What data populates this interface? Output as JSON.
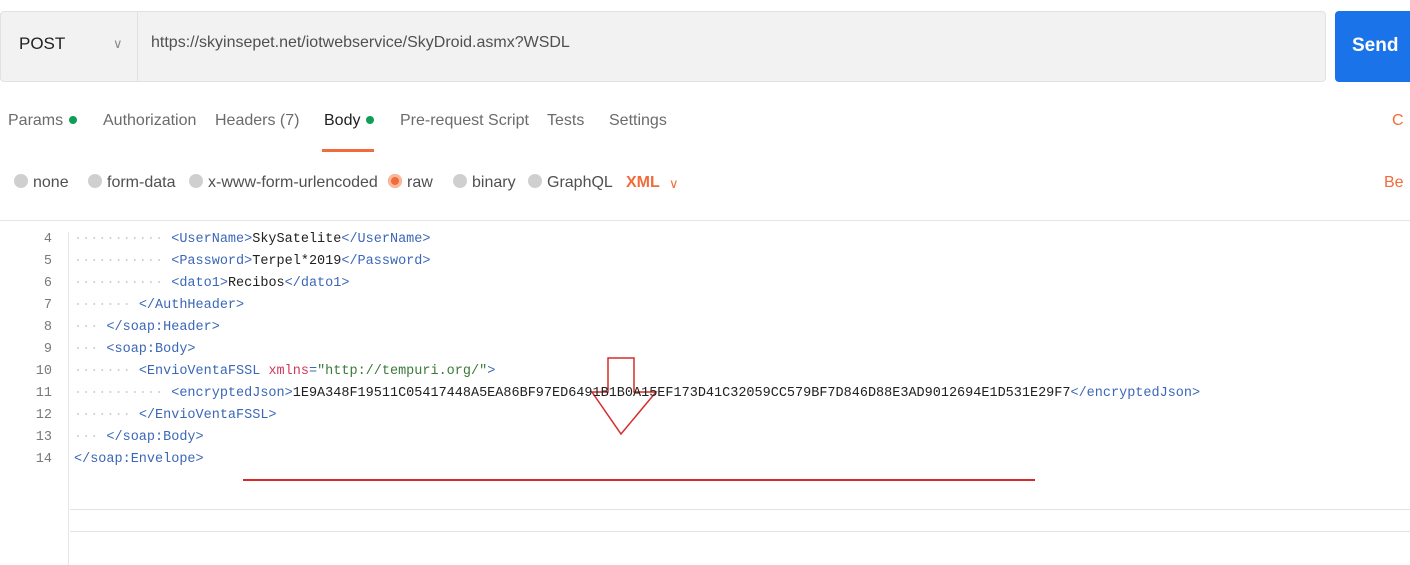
{
  "request": {
    "method": "POST",
    "url": "https://skyinsepet.net/iotwebservice/SkyDroid.asmx?WSDL",
    "send_label": "Send"
  },
  "tabs": [
    {
      "label": "Params",
      "dot": true
    },
    {
      "label": "Authorization",
      "dot": false
    },
    {
      "label": "Headers (7)",
      "dot": false
    },
    {
      "label": "Body",
      "dot": true,
      "active": true
    },
    {
      "label": "Pre-request Script",
      "dot": false
    },
    {
      "label": "Tests",
      "dot": false
    },
    {
      "label": "Settings",
      "dot": false
    }
  ],
  "cookies_label": "C",
  "body_types": [
    {
      "label": "none",
      "selected": false
    },
    {
      "label": "form-data",
      "selected": false
    },
    {
      "label": "x-www-form-urlencoded",
      "selected": false
    },
    {
      "label": "raw",
      "selected": true
    },
    {
      "label": "binary",
      "selected": false
    },
    {
      "label": "GraphQL",
      "selected": false
    }
  ],
  "format_label": "XML",
  "beautify_label": "Be",
  "code_lines": [
    {
      "num": "4",
      "indent": 3,
      "parts": [
        [
          "tg",
          "<UserName>"
        ],
        [
          "tx",
          "SkySatelite"
        ],
        [
          "tg",
          "</UserName>"
        ]
      ]
    },
    {
      "num": "5",
      "indent": 3,
      "parts": [
        [
          "tg",
          "<Password>"
        ],
        [
          "tx",
          "Terpel*2019"
        ],
        [
          "tg",
          "</Password>"
        ]
      ]
    },
    {
      "num": "6",
      "indent": 3,
      "parts": [
        [
          "tg",
          "<dato1>"
        ],
        [
          "tx",
          "Recibos"
        ],
        [
          "tg",
          "</dato1>"
        ]
      ]
    },
    {
      "num": "7",
      "indent": 2,
      "parts": [
        [
          "tg",
          "</AuthHeader>"
        ]
      ]
    },
    {
      "num": "8",
      "indent": 1,
      "parts": [
        [
          "tg",
          "</soap:Header>"
        ]
      ]
    },
    {
      "num": "9",
      "indent": 1,
      "parts": [
        [
          "tg",
          "<soap:Body>"
        ]
      ]
    },
    {
      "num": "10",
      "indent": 2,
      "parts": [
        [
          "tg",
          "<EnvioVentaFSSL "
        ],
        [
          "at",
          "xmlns"
        ],
        [
          "tg",
          "="
        ],
        [
          "sv",
          "\"http://tempuri.org/\""
        ],
        [
          "tg",
          ">"
        ]
      ]
    },
    {
      "num": "11",
      "indent": 3,
      "parts": [
        [
          "tg",
          "<encryptedJson>"
        ],
        [
          "tx",
          "1E9A348F19511C05417448A5EA86BF97ED6491B1B0A15EF173D41C32059CC579BF7D846D88E3AD9012694E1D531E29F7"
        ],
        [
          "tg",
          "</encryptedJson>"
        ]
      ]
    },
    {
      "num": "12",
      "indent": 2,
      "parts": [
        [
          "tg",
          "</EnvioVentaFSSL>"
        ]
      ]
    },
    {
      "num": "13",
      "indent": 1,
      "parts": [
        [
          "tg",
          "</soap:Body>"
        ]
      ]
    },
    {
      "num": "14",
      "indent": 0,
      "parts": [
        [
          "tg",
          "</soap:Envelope>"
        ]
      ]
    }
  ]
}
